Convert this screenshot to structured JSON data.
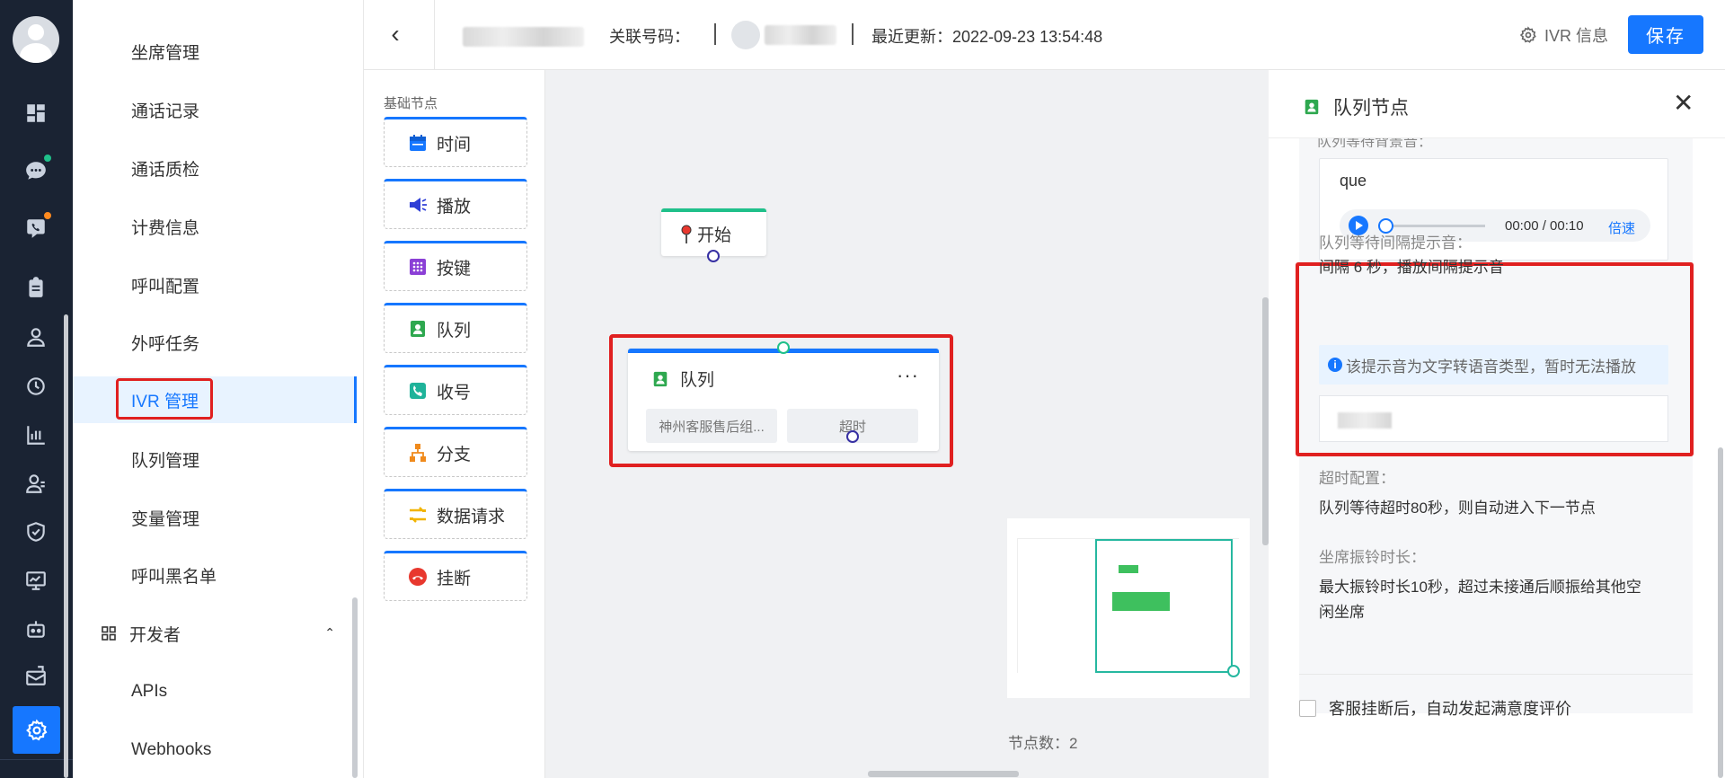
{
  "menu": {
    "items": [
      {
        "label": "坐席管理"
      },
      {
        "label": "通话记录"
      },
      {
        "label": "通话质检"
      },
      {
        "label": "计费信息"
      },
      {
        "label": "呼叫配置"
      },
      {
        "label": "外呼任务"
      },
      {
        "label": "IVR 管理"
      },
      {
        "label": "队列管理"
      },
      {
        "label": "变量管理"
      },
      {
        "label": "呼叫黑名单"
      }
    ],
    "group": {
      "label": "开发者"
    },
    "dev_items": [
      {
        "label": "APIs"
      },
      {
        "label": "Webhooks"
      }
    ],
    "active_index": 6
  },
  "topbar": {
    "related_number_label": "关联号码：",
    "last_update_label": "最近更新：2022-09-23 13:54:48",
    "ivr_info_label": "IVR 信息",
    "save_label": "保存"
  },
  "palette": {
    "title": "基础节点",
    "items": [
      {
        "label": "时间",
        "icon": "calendar-icon"
      },
      {
        "label": "播放",
        "icon": "speaker-icon"
      },
      {
        "label": "按键",
        "icon": "keypad-icon"
      },
      {
        "label": "队列",
        "icon": "queue-icon"
      },
      {
        "label": "收号",
        "icon": "phone-number-icon"
      },
      {
        "label": "分支",
        "icon": "branch-icon"
      },
      {
        "label": "数据请求",
        "icon": "data-request-icon"
      },
      {
        "label": "挂断",
        "icon": "hangup-icon"
      }
    ]
  },
  "canvas": {
    "start_node": {
      "label": "开始"
    },
    "queue_node": {
      "title": "队列",
      "more": "···",
      "chip_left": "神州客服售后组...",
      "chip_right": "超时"
    },
    "node_count": "节点数：2"
  },
  "panel": {
    "title": "队列节点",
    "cut_label": "队列等待背景音：",
    "audio_name": "que",
    "audio_time": "00:00 / 00:10",
    "audio_speed": "倍速",
    "interval_label": "队列等待间隔提示音：",
    "interval_value": "间隔 6 秒，播放间隔提示音",
    "tip_text": "该提示音为文字转语音类型，暂时无法播放",
    "timeout_label": "超时配置：",
    "timeout_value": "队列等待超时80秒，则自动进入下一节点",
    "ring_label": "坐席振铃时长：",
    "ring_value": "最大振铃时长10秒，超过未接通后顺振给其他空闲坐席",
    "checkbox_label": "客服挂断后，自动发起满意度评价"
  },
  "colors": {
    "accent": "#1677ff",
    "rail_bg": "#1a2333",
    "highlight": "#e02020",
    "start_green": "#1fc08a"
  }
}
